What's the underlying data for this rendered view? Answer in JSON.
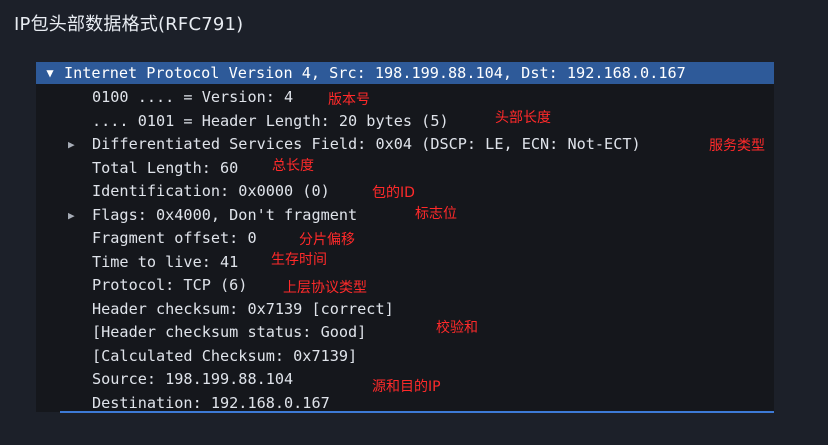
{
  "title": "IP包头部数据格式(RFC791)",
  "tree": {
    "header": "Internet Protocol Version 4, Src: 198.199.88.104, Dst: 192.168.0.167",
    "fields": [
      {
        "text": "0100 .... = Version: 4",
        "expandable": false
      },
      {
        "text": ".... 0101 = Header Length: 20 bytes (5)",
        "expandable": false
      },
      {
        "text": "Differentiated Services Field: 0x04 (DSCP: LE, ECN: Not-ECT)",
        "expandable": true
      },
      {
        "text": "Total Length: 60",
        "expandable": false
      },
      {
        "text": "Identification: 0x0000 (0)",
        "expandable": false
      },
      {
        "text": "Flags: 0x4000, Don't fragment",
        "expandable": true
      },
      {
        "text": "Fragment offset: 0",
        "expandable": false
      },
      {
        "text": "Time to live: 41",
        "expandable": false
      },
      {
        "text": "Protocol: TCP (6)",
        "expandable": false
      },
      {
        "text": "Header checksum: 0x7139 [correct]",
        "expandable": false
      },
      {
        "text": "[Header checksum status: Good]",
        "expandable": false
      },
      {
        "text": "[Calculated Checksum: 0x7139]",
        "expandable": false
      },
      {
        "text": "Source: 198.199.88.104",
        "expandable": false
      },
      {
        "text": "Destination: 192.168.0.167",
        "expandable": false
      }
    ]
  },
  "annotations": {
    "version": "版本号",
    "header_length": "头部长度",
    "service_type": "服务类型",
    "total_length": "总长度",
    "packet_id": "包的ID",
    "flags": "标志位",
    "fragment": "分片偏移",
    "ttl": "生存时间",
    "protocol": "上层协议类型",
    "checksum": "校验和",
    "addresses": "源和目的IP"
  },
  "colors": {
    "background": "#1c2029",
    "panel": "#15171c",
    "selected_row": "#2e5a99",
    "annotation": "#ff2a2a"
  }
}
